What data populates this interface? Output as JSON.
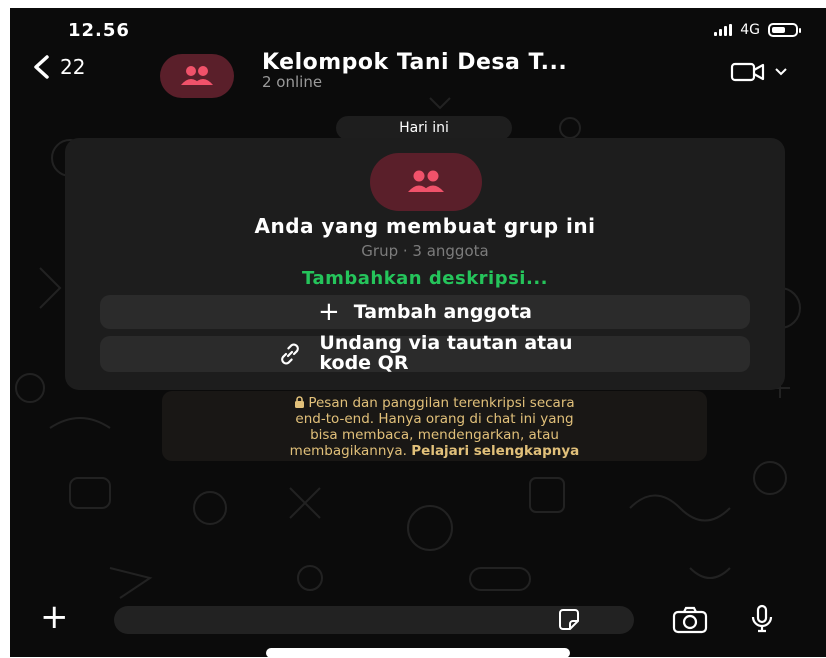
{
  "status_bar": {
    "time": "12.56",
    "network": "4G",
    "battery_level": 0.6
  },
  "header": {
    "back_count": "22",
    "title": "Kelompok Tani Desa T...",
    "subtitle": "2 online"
  },
  "date_chip": "Hari ini",
  "group_card": {
    "title": "Anda yang membuat grup ini",
    "subtitle": "Grup · 3 anggota",
    "add_description": "Tambahkan deskripsi...",
    "add_member_label": "Tambah anggota",
    "invite_label_line1": "Undang via tautan atau",
    "invite_label_line2": "kode QR"
  },
  "encryption_notice": {
    "line1": "Pesan dan panggilan terenkripsi secara",
    "line2": "end-to-end. Hanya orang di chat ini yang",
    "line3": "bisa membaca, mendengarkan, atau",
    "line4_prefix": "membagikannya.",
    "link": "Pelajari selengkapnya"
  },
  "icons": {
    "back": "chevron-left-icon",
    "group_avatar": "group-people-icon",
    "video_call": "video-camera-icon",
    "dropdown": "chevron-down-icon",
    "plus": "plus-icon",
    "link": "link-icon",
    "lock": "lock-icon",
    "sticker": "sticker-icon",
    "camera": "camera-icon",
    "mic": "microphone-icon"
  },
  "colors": {
    "accent_green": "#25c45b",
    "notice_text": "#e1c07a",
    "avatar_bg": "#5a1f2a",
    "avatar_icon": "#f0526a"
  }
}
